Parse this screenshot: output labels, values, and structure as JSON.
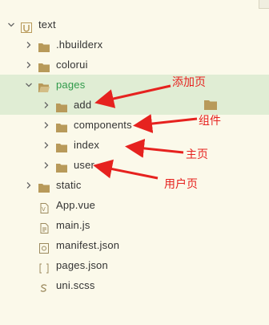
{
  "tree": [
    {
      "label": "text",
      "depth": 0,
      "icon": "project-folder-icon",
      "chevron": "down",
      "green": false,
      "highlight": false
    },
    {
      "label": ".hbuilderx",
      "depth": 1,
      "icon": "folder-icon",
      "chevron": "right",
      "green": false,
      "highlight": false
    },
    {
      "label": "colorui",
      "depth": 1,
      "icon": "folder-icon",
      "chevron": "right",
      "green": false,
      "highlight": false
    },
    {
      "label": "pages",
      "depth": 1,
      "icon": "open-folder-icon",
      "chevron": "down",
      "green": true,
      "highlight": true
    },
    {
      "label": "add",
      "depth": 2,
      "icon": "folder-icon",
      "chevron": "right",
      "green": false,
      "highlight": true
    },
    {
      "label": "components",
      "depth": 2,
      "icon": "folder-icon",
      "chevron": "right",
      "green": false,
      "highlight": false
    },
    {
      "label": "index",
      "depth": 2,
      "icon": "folder-icon",
      "chevron": "right",
      "green": false,
      "highlight": false
    },
    {
      "label": "user",
      "depth": 2,
      "icon": "folder-icon",
      "chevron": "right",
      "green": false,
      "highlight": false
    },
    {
      "label": "static",
      "depth": 1,
      "icon": "folder-icon",
      "chevron": "right",
      "green": false,
      "highlight": false
    },
    {
      "label": "App.vue",
      "depth": 1,
      "icon": "vue-file-icon",
      "chevron": "none",
      "green": false,
      "highlight": false
    },
    {
      "label": "main.js",
      "depth": 1,
      "icon": "file-icon",
      "chevron": "none",
      "green": false,
      "highlight": false
    },
    {
      "label": "manifest.json",
      "depth": 1,
      "icon": "manifest-file-icon",
      "chevron": "none",
      "green": false,
      "highlight": false
    },
    {
      "label": "pages.json",
      "depth": 1,
      "icon": "json-file-icon",
      "chevron": "none",
      "green": false,
      "highlight": false
    },
    {
      "label": "uni.scss",
      "depth": 1,
      "icon": "scss-file-icon",
      "chevron": "none",
      "green": false,
      "highlight": false
    }
  ],
  "annotations": [
    {
      "text": "添加页",
      "points_to": "add"
    },
    {
      "text": "组件",
      "points_to": "components"
    },
    {
      "text": "主页",
      "points_to": "index"
    },
    {
      "text": "用户页",
      "points_to": "user"
    }
  ],
  "colors": {
    "background": "#fbf9ea",
    "highlight": "#e0edd4",
    "folder": "#b89a5a",
    "annotation": "#e6221f",
    "green_label": "#2f9a4a"
  }
}
